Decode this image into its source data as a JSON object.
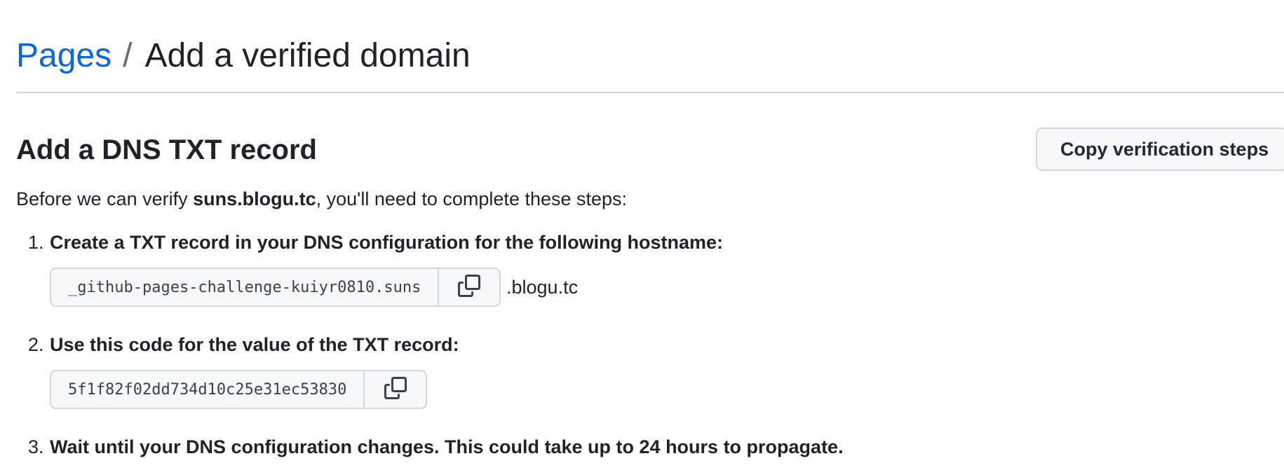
{
  "header": {
    "breadcrumb_link": "Pages",
    "separator": "/",
    "title": "Add a verified domain"
  },
  "section": {
    "title": "Add a DNS TXT record",
    "copy_steps_label": "Copy verification steps"
  },
  "intro": {
    "before": "Before we can verify ",
    "domain": "suns.blogu.tc",
    "after": ", you'll need to complete these steps:"
  },
  "steps": [
    {
      "number": "1.",
      "text": "Create a TXT record in your DNS configuration for the following hostname:",
      "field_value": "_github-pages-challenge-kuiyr0810.suns",
      "suffix": ".blogu.tc"
    },
    {
      "number": "2.",
      "text": "Use this code for the value of the TXT record:",
      "field_value": "5f1f82f02dd734d10c25e31ec53830"
    },
    {
      "number": "3.",
      "text": "Wait until your DNS configuration changes. This could take up to 24 hours to propagate."
    }
  ],
  "icons": {
    "copy": "copy-icon"
  }
}
